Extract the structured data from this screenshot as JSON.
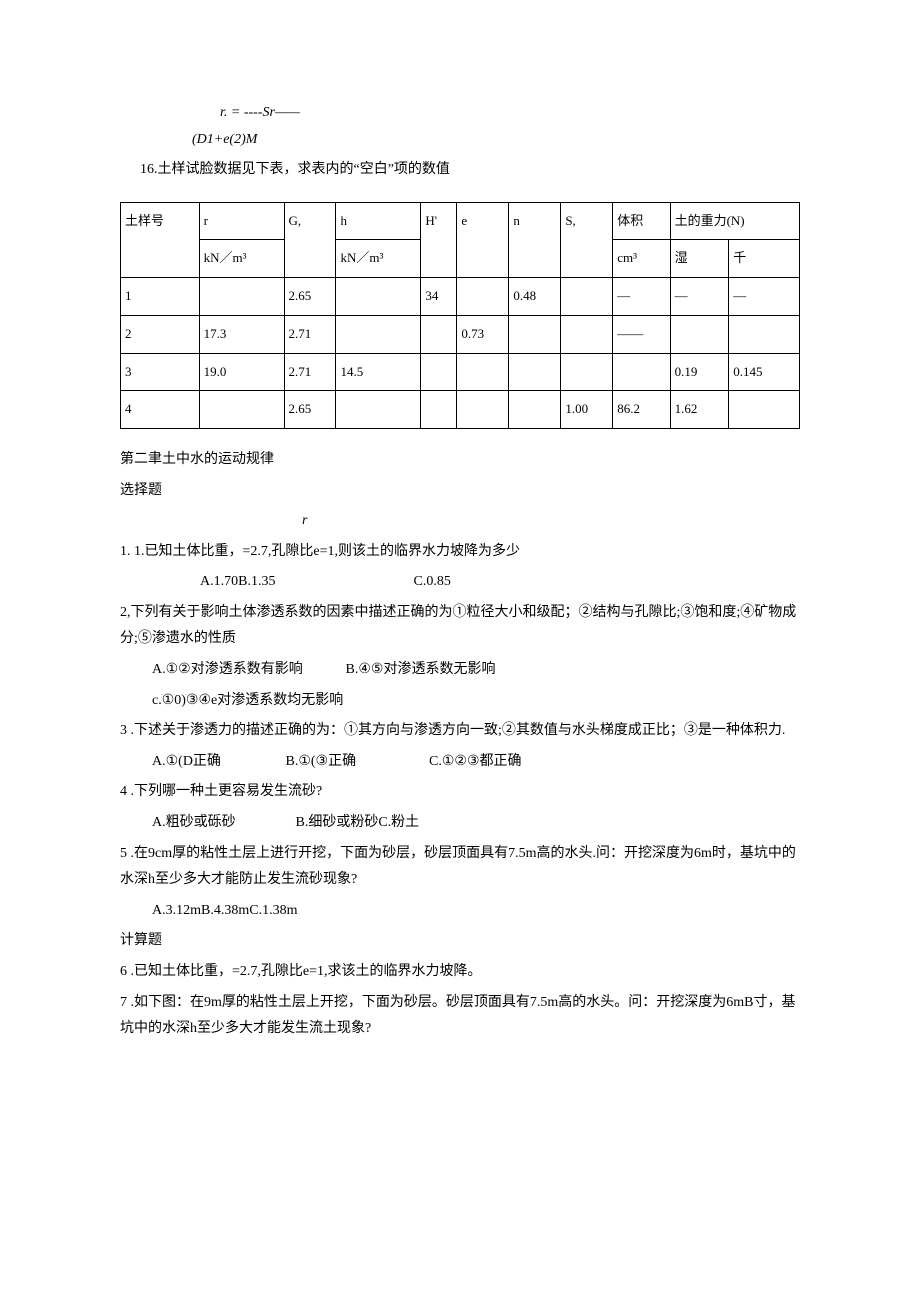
{
  "top": {
    "equation": "r. = ----Sr——",
    "subline": "(D1+e(2)M"
  },
  "q16": "16.土样试脸数据见下表，求表内的“空白”项的数值",
  "table": {
    "head1": {
      "c0": "土样号",
      "c1": "r",
      "c2": "G,",
      "c3": "h",
      "c4": "H'",
      "c5": "e",
      "c6": "n",
      "c7": "S,",
      "c8": "体积",
      "c9": "土的重力(N)"
    },
    "head2": {
      "c1": "kN／m³",
      "c3": "kN／m³",
      "c8": "cm³",
      "c9": "湿",
      "c10": "千"
    },
    "r1": {
      "c0": "1",
      "c1": "",
      "c2": "2.65",
      "c3": "",
      "c4": "34",
      "c5": "",
      "c6": "0.48",
      "c7": "",
      "c8": "—",
      "c9": "—",
      "c10": "—"
    },
    "r2": {
      "c0": "2",
      "c1": "17.3",
      "c2": "2.71",
      "c3": "",
      "c4": "",
      "c5": "0.73",
      "c6": "",
      "c7": "",
      "c8": "——",
      "c9": "",
      "c10": ""
    },
    "r3": {
      "c0": "3",
      "c1": "19.0",
      "c2": "2.71",
      "c3": "14.5",
      "c4": "",
      "c5": "",
      "c6": "",
      "c7": "",
      "c8": "",
      "c9": "0.19",
      "c10": "0.145"
    },
    "r4": {
      "c0": "4",
      "c1": "",
      "c2": "2.65",
      "c3": "",
      "c4": "",
      "c5": "",
      "c6": "",
      "c7": "1.00",
      "c8": "86.2",
      "c9": "1.62",
      "c10": ""
    }
  },
  "chapter2": "第二聿土中水的运动规律",
  "xz": "选择题",
  "loose_r": "r",
  "q1": {
    "line": "1. 1.已知土体比重，=2.7,孔隙比e=1,则该土的临界水力坡降为多少",
    "opts": "A.1.70B.1.35",
    "optc": "C.0.85"
  },
  "q2": {
    "line": "2,下列有关于影响土体渗透系数的因素中描述正确的为①粒径大小和级配；②结构与孔隙比;③饱和度;④矿物成分;⑤渗遗水的性质",
    "optA": "A.①②对渗透系数有影响",
    "optB": "B.④⑤对渗透系数无影响",
    "optC": "c.①0)③④e对渗透系数均无影响"
  },
  "q3": {
    "line": "3 .下述关于渗透力的描述正确的为：①其方向与渗透方向一致;②其数值与水头梯度成正比；③是一种体积力.",
    "optA": "A.①(D正确",
    "optB": "B.①(③正确",
    "optC": "C.①②③都正确"
  },
  "q4": {
    "line": "4 .下列哪一种土更容易发生流砂?",
    "optA": "A.粗砂或砾砂",
    "optB": "B.细砂或粉砂C.粉土"
  },
  "q5": {
    "line": "5 .在9cm厚的粘性土层上进行开挖，下面为砂层，砂层顶面具有7.5m高的水头.问：开挖深度为6m时，基坑中的水深h至少多大才能防止发生流砂现象?",
    "optA": "A.3.12mB.4.38mC.1.38m"
  },
  "calc": "计算题",
  "q6": "6 .已知土体比重，=2.7,孔隙比e=1,求该土的临界水力坡降。",
  "q7": "7 .如下图：在9m厚的粘性土层上开挖，下面为砂层。砂层顶面具有7.5m高的水头。问：开挖深度为6mB寸，基坑中的水深h至少多大才能发生流土现象?"
}
